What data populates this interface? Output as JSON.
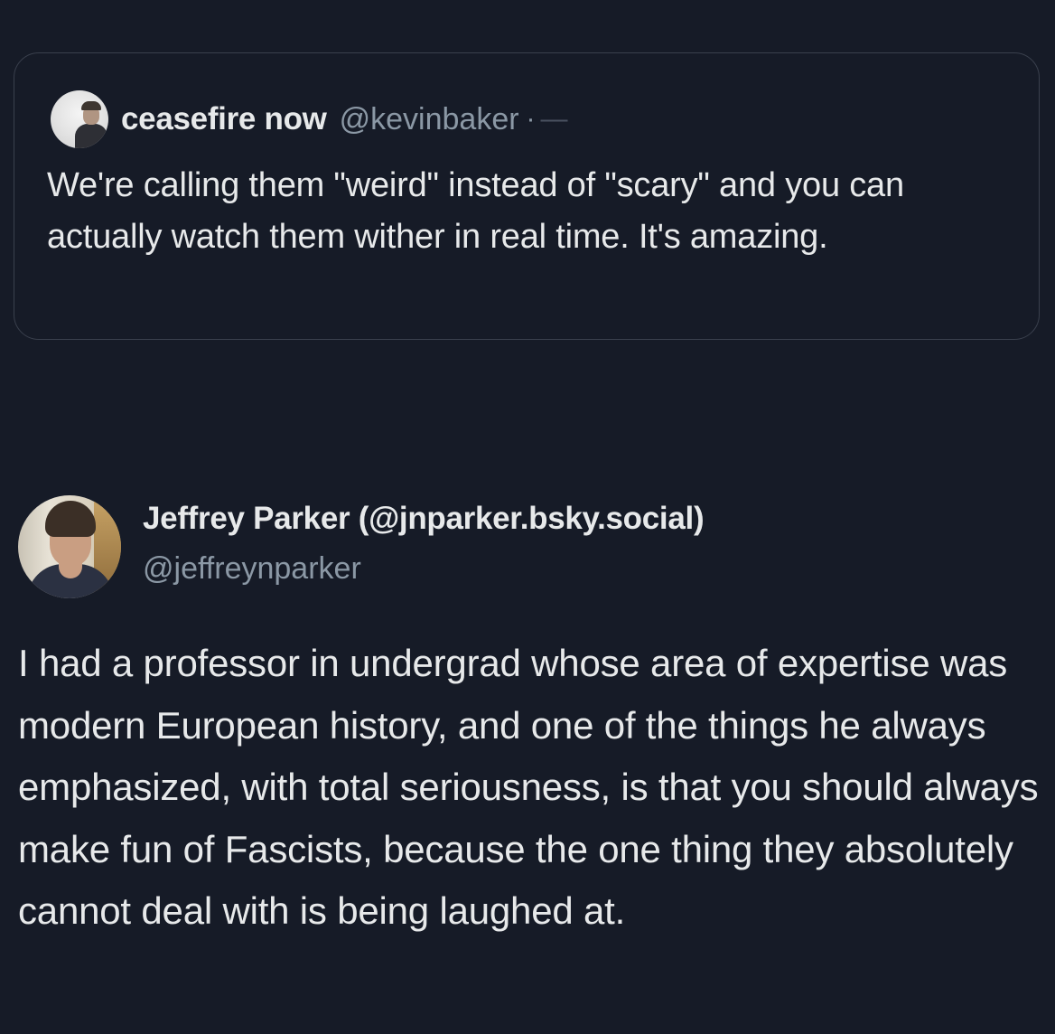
{
  "quoted_post": {
    "display_name": "ceasefire now",
    "handle": "@kevinbaker",
    "separator": "·",
    "timestamp_placeholder": "—",
    "text": "We're calling them \"weird\" instead of \"scary\" and you can actually watch them wither in real time. It's amazing."
  },
  "post": {
    "display_name": "Jeffrey Parker (@jnparker.bsky.social)",
    "handle": "@jeffreynparker",
    "text": "I had a professor in undergrad whose area of expertise was modern European history, and one of the things he always emphasized, with total seriousness, is that you should always make fun of Fascists, because the one thing they absolutely cannot deal with is being laughed at."
  },
  "colors": {
    "background": "#161b27",
    "text_primary": "#e7e9ea",
    "text_secondary": "#8b98a5",
    "card_border": "#3a404d"
  }
}
